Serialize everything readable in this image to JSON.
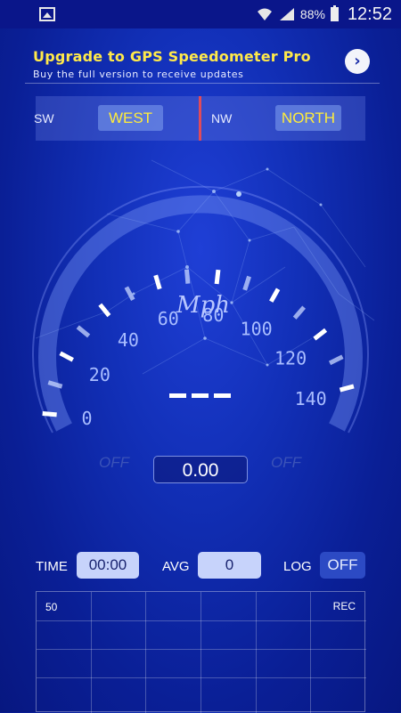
{
  "status_bar": {
    "battery_percent": "88%",
    "time": "12:52",
    "icons": [
      "gallery-icon",
      "wifi-icon",
      "signal-icon",
      "battery-icon"
    ]
  },
  "ad": {
    "title": "Upgrade to GPS Speedometer Pro",
    "subtitle": "Buy the full version to receive updates",
    "arrow_icon": "chevron-right-icon",
    "title_color": "#ffe94a"
  },
  "compass": {
    "left_small": "SW",
    "left_direction": "WEST",
    "right_small": "NW",
    "right_direction": "NORTH",
    "needle_color": "#e04b5a",
    "direction_color": "#ffed3a"
  },
  "gauge": {
    "unit": "Mph",
    "speed_display": "---",
    "scale_labels": [
      "0",
      "20",
      "40",
      "60",
      "80",
      "100",
      "120",
      "140"
    ],
    "left_status": "OFF",
    "right_status": "OFF",
    "odometer": "0.00"
  },
  "controls": {
    "time_label": "TIME",
    "time_value": "00:00",
    "avg_label": "AVG",
    "avg_value": "0",
    "log_label": "LOG",
    "log_toggle": "OFF"
  },
  "graph": {
    "max_label": "50",
    "rec_label": "REC"
  }
}
